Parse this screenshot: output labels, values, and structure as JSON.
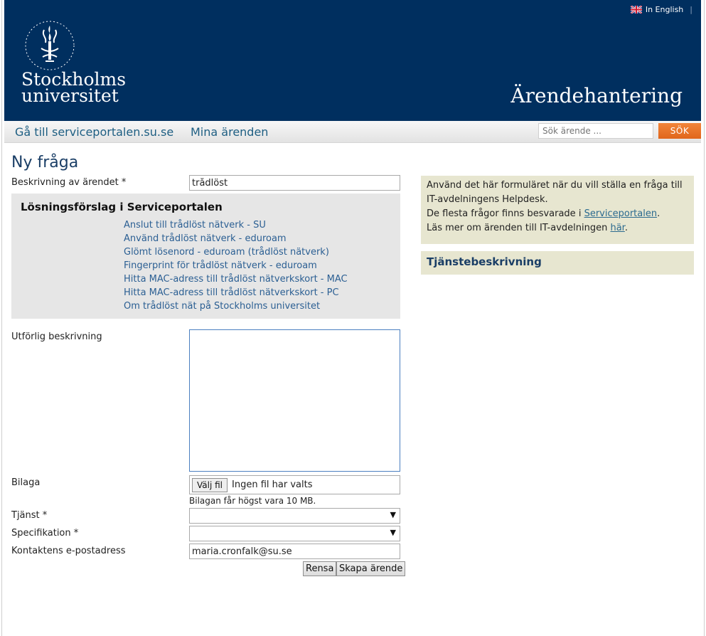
{
  "header": {
    "language_link": "In English",
    "logo_line1": "Stockholms",
    "logo_line2": "universitet",
    "site_title": "Ärendehantering"
  },
  "nav": {
    "link1": "Gå till serviceportalen.su.se",
    "link2": "Mina ärenden",
    "search_placeholder": "Sök ärende ...",
    "search_button": "SÖK"
  },
  "page": {
    "title": "Ny fråga"
  },
  "form": {
    "desc_label": "Beskrivning av ärendet *",
    "desc_value": "trådlöst",
    "suggestions_title": "Lösningsförslag i Serviceportalen",
    "suggestions": [
      "Anslut till trådlöst nätverk - SU",
      "Använd trådlöst nätverk - eduroam",
      "Glömt lösenord - eduroam (trådlöst nätverk)",
      "Fingerprint för trådlöst nätverk - eduroam",
      "Hitta MAC-adress till trådlöst nätverkskort - MAC",
      "Hitta MAC-adress till trådlöst nätverkskort - PC",
      "Om trådlöst nät på Stockholms universitet"
    ],
    "detail_label": "Utförlig beskrivning",
    "attachment_label": "Bilaga",
    "file_button": "Välj fil",
    "file_status": "Ingen fil har valts",
    "attachment_hint": "Bilagan får högst vara 10 MB.",
    "service_label": "Tjänst *",
    "spec_label": "Specifikation *",
    "email_label": "Kontaktens e-postadress",
    "email_value": "maria.cronfalk@su.se",
    "reset_button": "Rensa",
    "submit_button": "Skapa ärende"
  },
  "sidebar": {
    "info_line1": "Använd det här formuläret när du vill ställa en fråga till IT-avdelningens Helpdesk.",
    "info_line2_prefix": "De flesta frågor finns besvarade i ",
    "info_line2_link": "Serviceportalen",
    "info_line2_suffix": ".",
    "info_line3_prefix": "Läs mer om ärenden till IT-avdelningen ",
    "info_line3_link": "här",
    "info_line3_suffix": ".",
    "service_heading": "Tjänstebeskrivning"
  },
  "colors": {
    "header_bg": "#002f5f",
    "search_button": "#e8722a",
    "sidebar_bg": "#e7e6d0"
  }
}
